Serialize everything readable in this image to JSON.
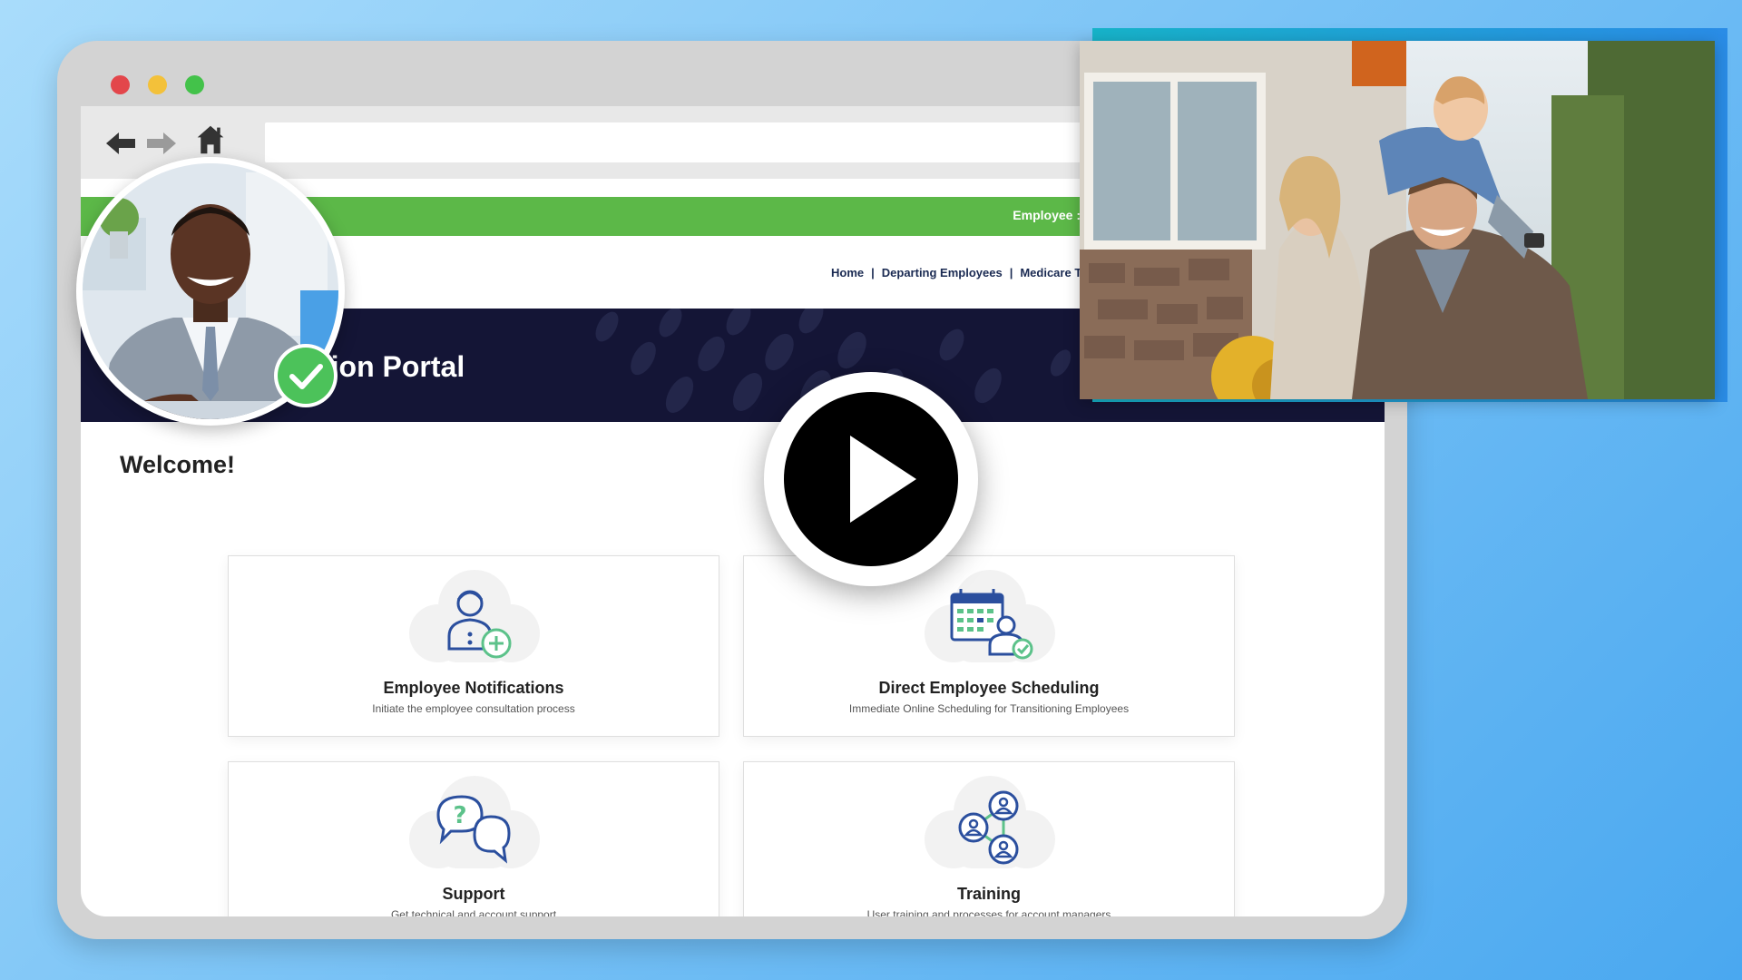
{
  "window": {
    "controls": [
      "close",
      "minimize",
      "maximize"
    ],
    "nav_icons": [
      "back-arrow-icon",
      "forward-arrow-icon",
      "home-icon"
    ],
    "address_value": ""
  },
  "site": {
    "top_link": "Employee :",
    "menu": {
      "home": "Home",
      "separator": "|",
      "departing": "Departing Employees",
      "medicare": "Medicare T"
    },
    "banner_title": "tion Portal",
    "welcome": "Welcome!"
  },
  "cards": [
    {
      "title": "Employee Notifications",
      "desc": "Initiate the employee consultation process",
      "icon": "employee-add-icon"
    },
    {
      "title": "Direct Employee Scheduling",
      "desc": "Immediate Online Scheduling for Transitioning Employees",
      "icon": "calendar-scheduling-icon"
    },
    {
      "title": "Support",
      "desc": "Get technical and account support",
      "icon": "support-chat-icon"
    },
    {
      "title": "Training",
      "desc": "User training and processes for account managers",
      "icon": "training-network-icon"
    }
  ],
  "overlays": {
    "avatar": "businessman-avatar",
    "badge": "verified-check-icon",
    "photo": "family-photo",
    "video": "play-icon"
  },
  "colors": {
    "brand_green": "#5cb848",
    "banner_navy": "#141536",
    "icon_blue": "#2b4f9e",
    "icon_green": "#5cc28a",
    "background_blue": "#7cc4f6"
  }
}
